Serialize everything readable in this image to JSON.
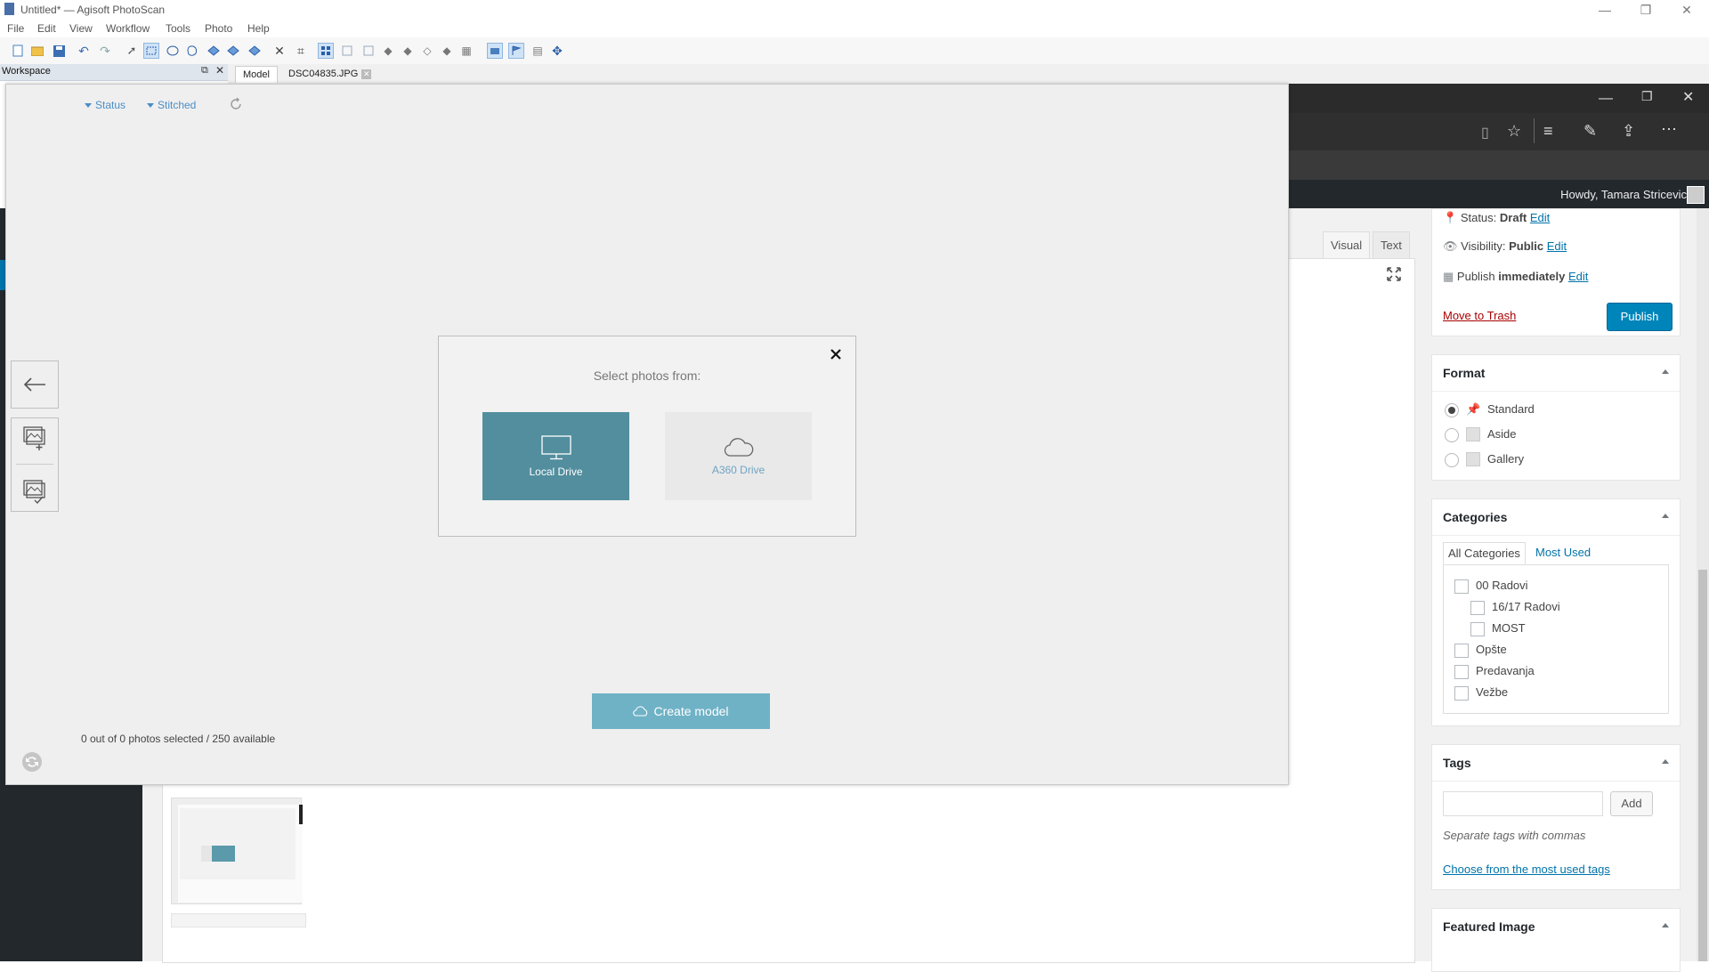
{
  "app": {
    "title": "Untitled* — Agisoft PhotoScan",
    "menu": [
      "File",
      "Edit",
      "View",
      "Workflow",
      "Tools",
      "Photo",
      "Help"
    ],
    "workspace_label": "Workspace",
    "tabs": [
      {
        "label": "Model",
        "active": true
      },
      {
        "label": "DSC04835.JPG",
        "active": false
      }
    ]
  },
  "panel": {
    "filters": {
      "status_label": "Status",
      "stitched_label": "Stitched"
    },
    "dialog": {
      "title": "Select photos from:",
      "options": [
        {
          "label": "Local Drive",
          "icon": "monitor-icon",
          "selected": true
        },
        {
          "label": "A360 Drive",
          "icon": "cloud-icon",
          "selected": false
        }
      ]
    },
    "create_button": "Create model",
    "photo_count": "0 out of 0 photos selected / 250 available"
  },
  "wordpress": {
    "howdy": "Howdy, Tamara Stricevic",
    "editor_tabs": {
      "visual": "Visual",
      "text": "Text"
    },
    "publish": {
      "status_label": "Status:",
      "status_value": "Draft",
      "visibility_label": "Visibility:",
      "visibility_value": "Public",
      "publish_label": "Publish",
      "publish_value": "immediately",
      "edit": "Edit",
      "trash": "Move to Trash",
      "button": "Publish"
    },
    "format": {
      "title": "Format",
      "options": [
        {
          "label": "Standard",
          "checked": true
        },
        {
          "label": "Aside",
          "checked": false
        },
        {
          "label": "Gallery",
          "checked": false
        }
      ]
    },
    "categories": {
      "title": "Categories",
      "tab_all": "All Categories",
      "tab_most": "Most Used",
      "items": [
        {
          "label": "00 Radovi",
          "level": 0
        },
        {
          "label": "16/17 Radovi",
          "level": 1
        },
        {
          "label": "MOST",
          "level": 1
        },
        {
          "label": "Opšte",
          "level": 0
        },
        {
          "label": "Predavanja",
          "level": 0
        },
        {
          "label": "Vežbe",
          "level": 0
        }
      ]
    },
    "tags": {
      "title": "Tags",
      "add": "Add",
      "hint": "Separate tags with commas",
      "choose_link": "Choose from the most used tags"
    },
    "featured": {
      "title": "Featured Image"
    }
  },
  "colors": {
    "local_drive": "#528e9e",
    "create_button": "#6fb2c6",
    "link_blue": "#0073aa",
    "filter_blue": "#4a8ec6"
  }
}
